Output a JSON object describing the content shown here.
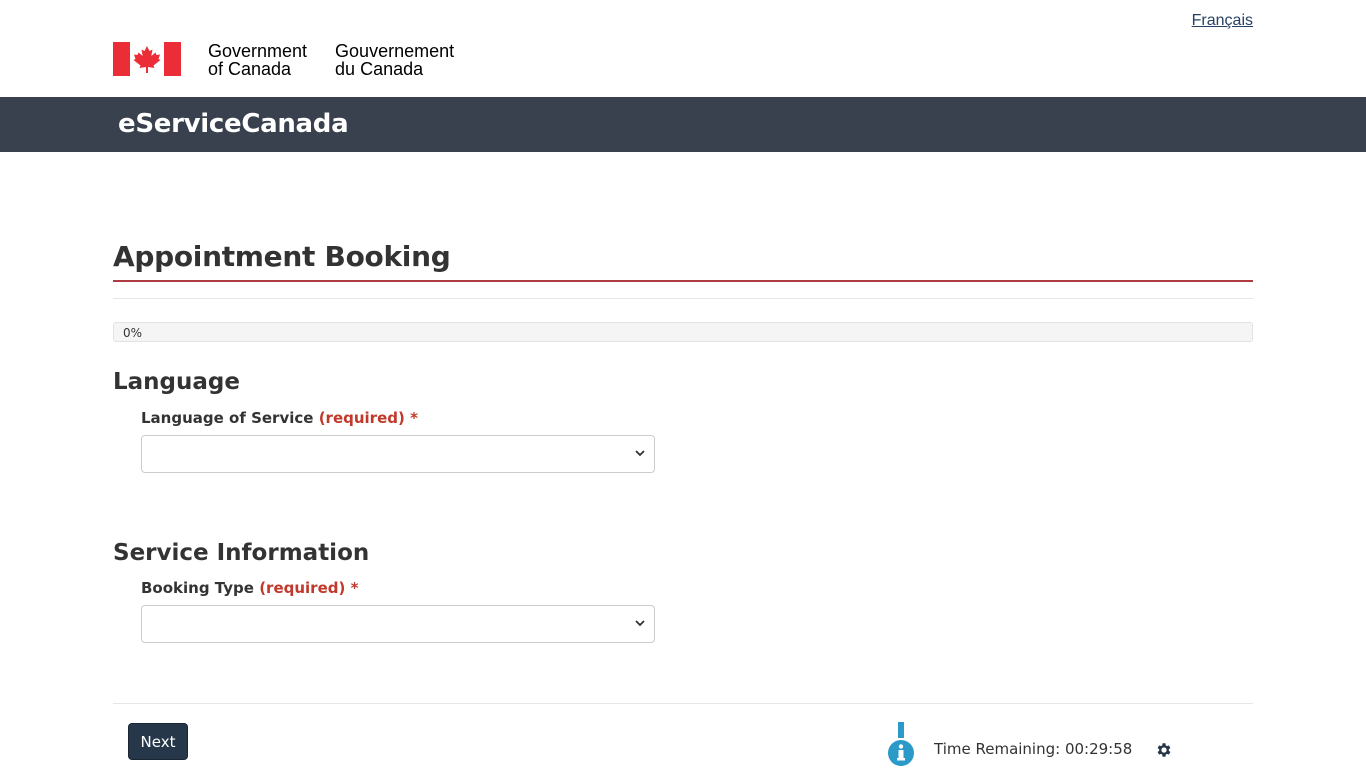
{
  "header": {
    "language_toggle": "Français",
    "wordmark_en_line1": "Government",
    "wordmark_en_line2": "of Canada",
    "wordmark_fr_line1": "Gouvernement",
    "wordmark_fr_line2": "du Canada",
    "flag_icon": "canada-flag-icon"
  },
  "app_bar": {
    "title": "eServiceCanada"
  },
  "page": {
    "title": "Appointment Booking",
    "progress": {
      "label": "0%",
      "value_percent": 0
    }
  },
  "sections": {
    "language": {
      "heading": "Language",
      "field_label": "Language of Service",
      "required_text": "(required)",
      "asterisk": "*",
      "selected_value": ""
    },
    "service": {
      "heading": "Service Information",
      "field_label": "Booking Type",
      "required_text": "(required)",
      "asterisk": "*",
      "selected_value": ""
    }
  },
  "footer": {
    "next_label": "Next",
    "timer_text": "Time Remaining: 00:29:58",
    "info_icon": "info-icon",
    "settings_icon": "gear-icon"
  },
  "colors": {
    "app_bar": "#38414d",
    "accent_rule": "#af3c43",
    "required": "#c0392b",
    "button": "#26374a",
    "link": "#284162",
    "info": "#2b9ac8",
    "flag_red": "#eb2d37"
  }
}
